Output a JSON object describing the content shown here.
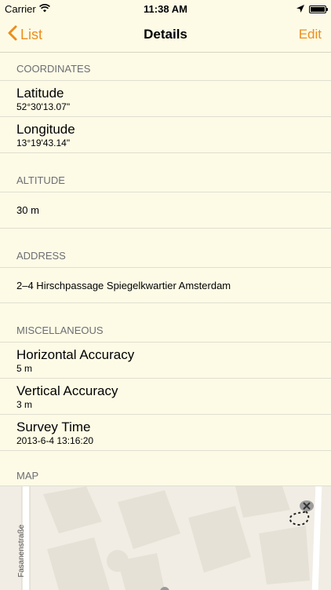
{
  "status_bar": {
    "carrier": "Carrier",
    "time": "11:38 AM",
    "icons": [
      "wifi-icon",
      "location-arrow-icon",
      "battery-icon"
    ]
  },
  "navbar": {
    "back_label": "List",
    "title": "Details",
    "edit_label": "Edit"
  },
  "sections": {
    "coordinates": {
      "header": "COORDINATES",
      "latitude_label": "Latitude",
      "latitude_value": "52°30'13.07\"",
      "longitude_label": "Longitude",
      "longitude_value": "13°19'43.14\""
    },
    "altitude": {
      "header": "ALTITUDE",
      "value": "30 m"
    },
    "address": {
      "header": "ADDRESS",
      "value": "2–4 Hirschpassage Spiegelkwartier Amsterdam"
    },
    "misc": {
      "header": "MISCELLANEOUS",
      "horizontal_label": "Horizontal Accuracy",
      "horizontal_value": "5 m",
      "vertical_label": "Vertical Accuracy",
      "vertical_value": "3 m",
      "survey_label": "Survey Time",
      "survey_value": "2013-6-4 13:16:20"
    },
    "map": {
      "header": "MAP",
      "street_name": "Fasanenstraße"
    }
  },
  "colors": {
    "accent": "#ec8d1c",
    "background": "#fdfbe6",
    "section_header": "#6d6d72"
  }
}
